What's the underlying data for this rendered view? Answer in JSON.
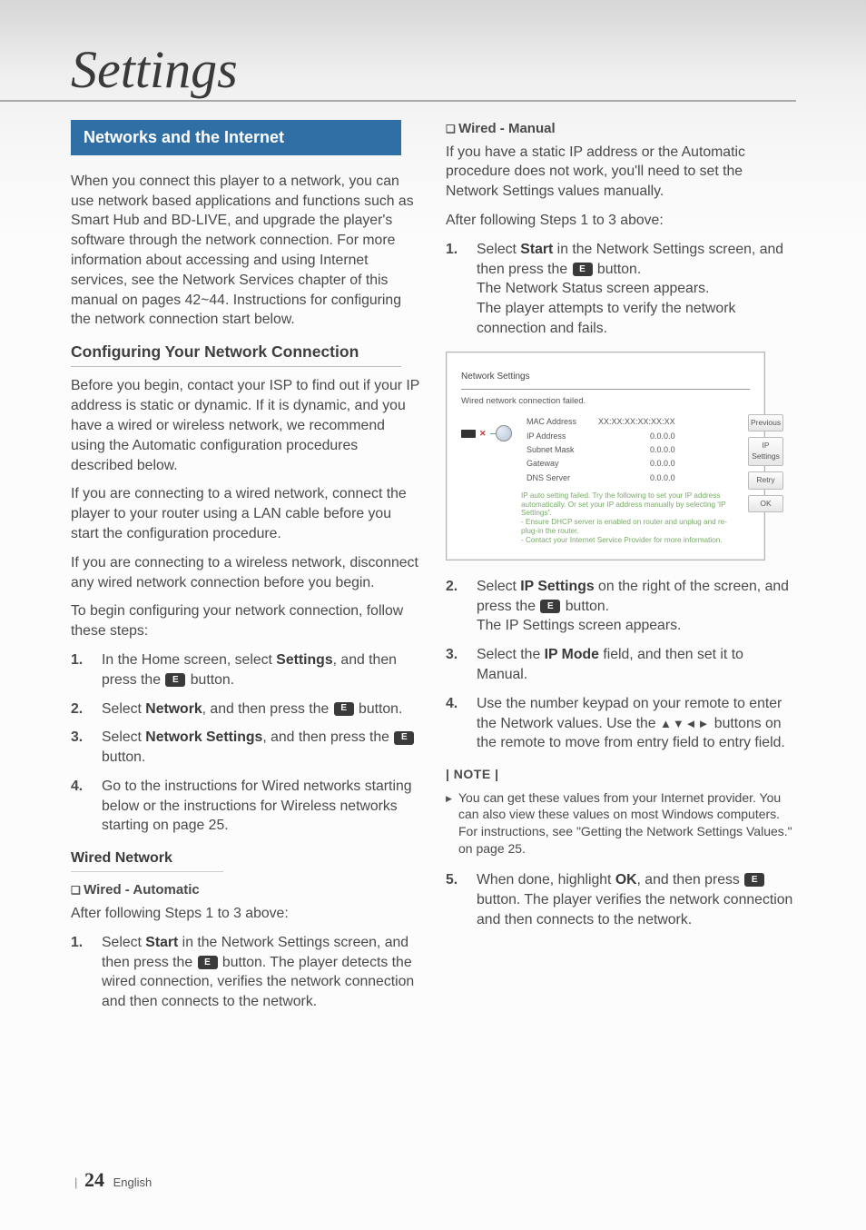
{
  "page_title": "Settings",
  "footer": {
    "page_number": "24",
    "lang": "English",
    "separator": "|"
  },
  "left": {
    "section_heading": "Networks and the Internet",
    "intro": "When you connect this player to a network, you can use network based applications and functions such as Smart Hub and BD-LIVE, and upgrade the player's software through the network connection. For more information about accessing and using Internet services, see the Network Services chapter of this manual on pages 42~44. Instructions for configuring the network connection start below.",
    "config_heading": "Configuring Your Network Connection",
    "p1": "Before you begin, contact your ISP to find out if your IP address is static or dynamic. If it is dynamic, and you have a wired or wireless network, we recommend using the Automatic configuration procedures described below.",
    "p2": "If you are connecting to a wired network, connect the player to your router using a LAN cable before you start the configuration procedure.",
    "p3": "If you are connecting to a wireless network, disconnect any wired network connection before you begin.",
    "p4": "To begin configuring your network connection, follow these steps:",
    "steps": [
      {
        "pre": "In the Home screen, select ",
        "bold": "Settings",
        "post": ", and then press the ",
        "tail": " button."
      },
      {
        "pre": "Select ",
        "bold": "Network",
        "post": ", and then press the ",
        "tail": " button."
      },
      {
        "pre": "Select ",
        "bold": "Network Settings",
        "post": ", and then press the ",
        "tail": " button."
      },
      {
        "text": "Go to the instructions for Wired networks starting below or the instructions for Wireless networks starting on page 25."
      }
    ],
    "wired_heading": "Wired Network",
    "wired_auto_heading": "Wired - Automatic",
    "wired_auto_intro": "After following Steps 1 to 3 above:",
    "wired_auto_step": {
      "pre": "Select ",
      "bold": "Start",
      "post": " in the Network Settings screen, and then press the ",
      "tail": " button. The player detects the wired connection, verifies the network connection and then connects to the network."
    }
  },
  "right": {
    "wired_manual_heading": "Wired - Manual",
    "wm_p1": "If you have a static IP address or the Automatic procedure does not work, you'll need to set the Network Settings values manually.",
    "wm_p2": "After following Steps 1 to 3 above:",
    "wm_step1": {
      "pre": "Select ",
      "bold": "Start",
      "post": " in the Network Settings screen, and then press the ",
      "mid": " button.",
      "line2": "The Network Status screen appears.",
      "line3": "The player attempts to verify the network connection and fails."
    },
    "screenshot": {
      "title": "Network Settings",
      "status": "Wired network connection failed.",
      "rows": [
        {
          "k": "MAC Address",
          "v": "XX:XX:XX:XX:XX:XX"
        },
        {
          "k": "IP Address",
          "v": "0.0.0.0"
        },
        {
          "k": "Subnet Mask",
          "v": "0.0.0.0"
        },
        {
          "k": "Gateway",
          "v": "0.0.0.0"
        },
        {
          "k": "DNS Server",
          "v": "0.0.0.0"
        }
      ],
      "detail": "IP auto setting failed. Try the following to set your IP address automatically. Or set your IP address manually by selecting 'IP Settings'.\n- Ensure DHCP server is enabled on router and unplug and re-plug-in the router.\n- Contact your Internet Service Provider for more information.",
      "buttons": [
        "Previous",
        "IP Settings",
        "Retry",
        "OK"
      ]
    },
    "wm_step2": {
      "pre": "Select ",
      "bold": "IP Settings",
      "post": " on the right of the screen, and press the ",
      "mid": " button.",
      "line2": "The IP Settings screen appears."
    },
    "wm_step3": {
      "pre": "Select the ",
      "bold": "IP Mode",
      "post": " field, and then set it to Manual."
    },
    "wm_step4": {
      "text_a": "Use the number keypad on your remote to enter the Network values. Use the ",
      "arrows": "▲▼◄►",
      "text_b": " buttons on the remote to move from entry field to entry field."
    },
    "note_label": "| NOTE |",
    "note_body": "You can get these values from your Internet provider. You can also view these values on most Windows computers. For instructions, see \"Getting the Network Settings Values.\" on page 25.",
    "wm_step5": {
      "pre": "When done, highlight ",
      "bold": "OK",
      "post": ", and then press ",
      "mid": " button. The player verifies the network connection and then connects to the network."
    }
  },
  "icon_label": "E"
}
